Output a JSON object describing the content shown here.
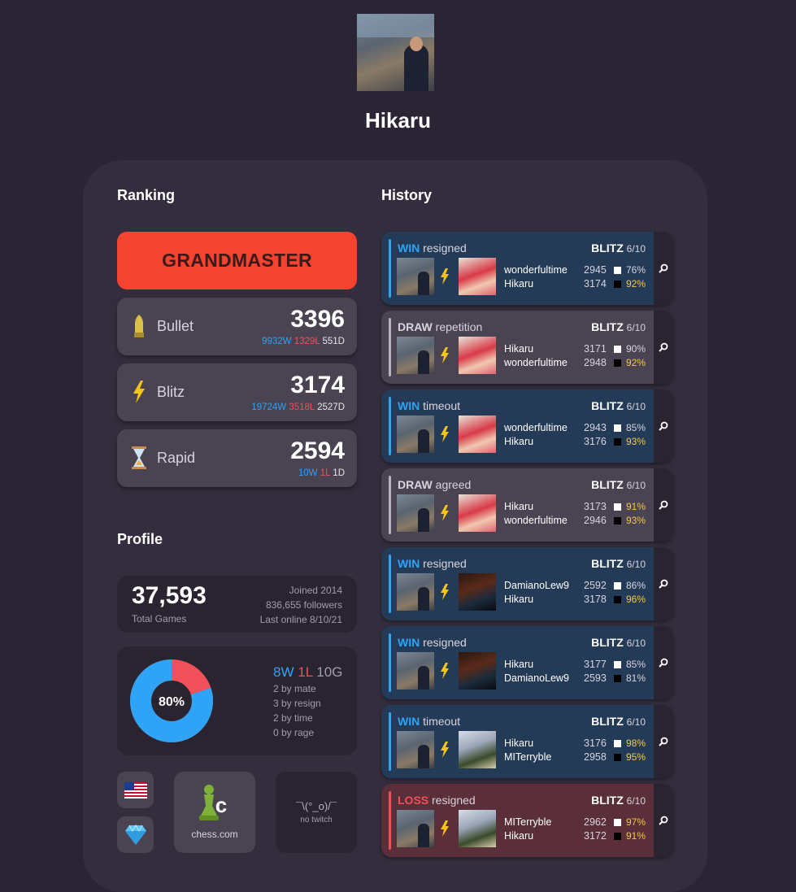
{
  "profile": {
    "username": "Hikaru"
  },
  "sections": {
    "ranking": "Ranking",
    "history": "History",
    "profile": "Profile"
  },
  "ranking": {
    "title": "GRANDMASTER",
    "ratings": [
      {
        "name": "Bullet",
        "icon": "bullet-icon",
        "value": "3396",
        "wins": "9932W",
        "losses": "1329L",
        "draws": "551D"
      },
      {
        "name": "Blitz",
        "icon": "lightning-icon",
        "value": "3174",
        "wins": "19724W",
        "losses": "3518L",
        "draws": "2527D"
      },
      {
        "name": "Rapid",
        "icon": "hourglass-icon",
        "value": "2594",
        "wins": "10W",
        "losses": "1L",
        "draws": "1D"
      }
    ]
  },
  "stats": {
    "total_games": "37,593",
    "total_label": "Total Games",
    "joined": "Joined 2014",
    "followers": "836,655 followers",
    "last_online": "Last online 8/10/21",
    "win_pct": "80%",
    "win_fraction": 0.8,
    "wins": "8W",
    "losses": "1L",
    "games": "10G",
    "by_mate": "2 by mate",
    "by_resign": "3 by resign",
    "by_time": "2 by time",
    "by_rage": "0 by rage"
  },
  "links": {
    "flag": "us-flag-icon",
    "premium": "diamond-icon",
    "site": "chess.com",
    "twitch_face": "¯\\(°_o)/¯",
    "twitch_label": "no twitch"
  },
  "colors": {
    "win": "#2fa3f5",
    "loss": "#f0505a",
    "grandmaster": "#f4432e",
    "accuracy_high": "#f5c84a"
  },
  "history": [
    {
      "result": "WIN",
      "method": "resigned",
      "mode": "BLITZ",
      "date": "6/10",
      "opp": "wonder",
      "players": [
        {
          "name": "wonderfultime",
          "rating": "2945",
          "color": "white",
          "acc": "76%",
          "hi": false
        },
        {
          "name": "Hikaru",
          "rating": "3174",
          "color": "black",
          "acc": "92%",
          "hi": true
        }
      ]
    },
    {
      "result": "DRAW",
      "method": "repetition",
      "mode": "BLITZ",
      "date": "6/10",
      "opp": "wonder",
      "players": [
        {
          "name": "Hikaru",
          "rating": "3171",
          "color": "white",
          "acc": "90%",
          "hi": false
        },
        {
          "name": "wonderfultime",
          "rating": "2948",
          "color": "black",
          "acc": "92%",
          "hi": true
        }
      ]
    },
    {
      "result": "WIN",
      "method": "timeout",
      "mode": "BLITZ",
      "date": "6/10",
      "opp": "wonder",
      "players": [
        {
          "name": "wonderfultime",
          "rating": "2943",
          "color": "white",
          "acc": "85%",
          "hi": false
        },
        {
          "name": "Hikaru",
          "rating": "3176",
          "color": "black",
          "acc": "93%",
          "hi": true
        }
      ]
    },
    {
      "result": "DRAW",
      "method": "agreed",
      "mode": "BLITZ",
      "date": "6/10",
      "opp": "wonder",
      "players": [
        {
          "name": "Hikaru",
          "rating": "3173",
          "color": "white",
          "acc": "91%",
          "hi": true
        },
        {
          "name": "wonderfultime",
          "rating": "2946",
          "color": "black",
          "acc": "93%",
          "hi": true
        }
      ]
    },
    {
      "result": "WIN",
      "method": "resigned",
      "mode": "BLITZ",
      "date": "6/10",
      "opp": "damiano",
      "players": [
        {
          "name": "DamianoLew9",
          "rating": "2592",
          "color": "white",
          "acc": "86%",
          "hi": false
        },
        {
          "name": "Hikaru",
          "rating": "3178",
          "color": "black",
          "acc": "96%",
          "hi": true
        }
      ]
    },
    {
      "result": "WIN",
      "method": "resigned",
      "mode": "BLITZ",
      "date": "6/10",
      "opp": "damiano",
      "players": [
        {
          "name": "Hikaru",
          "rating": "3177",
          "color": "white",
          "acc": "85%",
          "hi": false
        },
        {
          "name": "DamianoLew9",
          "rating": "2593",
          "color": "black",
          "acc": "81%",
          "hi": false
        }
      ]
    },
    {
      "result": "WIN",
      "method": "timeout",
      "mode": "BLITZ",
      "date": "6/10",
      "opp": "mit",
      "players": [
        {
          "name": "Hikaru",
          "rating": "3176",
          "color": "white",
          "acc": "98%",
          "hi": true
        },
        {
          "name": "MITerryble",
          "rating": "2958",
          "color": "black",
          "acc": "95%",
          "hi": true
        }
      ]
    },
    {
      "result": "LOSS",
      "method": "resigned",
      "mode": "BLITZ",
      "date": "6/10",
      "opp": "mit",
      "players": [
        {
          "name": "MITerryble",
          "rating": "2962",
          "color": "white",
          "acc": "97%",
          "hi": true
        },
        {
          "name": "Hikaru",
          "rating": "3172",
          "color": "black",
          "acc": "91%",
          "hi": true
        }
      ]
    }
  ]
}
